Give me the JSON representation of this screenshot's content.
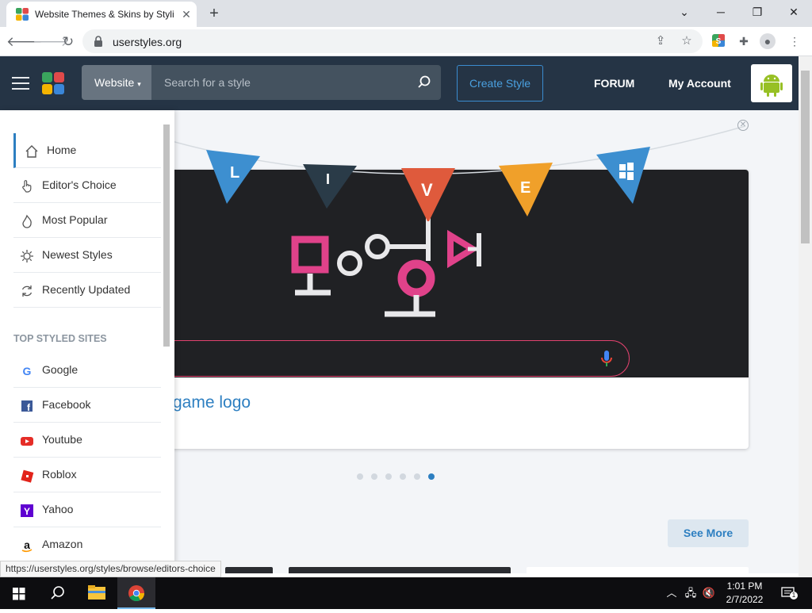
{
  "browser": {
    "tab_title": "Website Themes & Skins by Stylish",
    "url": "userstyles.org",
    "status_url": "https://userstyles.org/styles/browse/editors-choice"
  },
  "header": {
    "category_label": "Website",
    "search_placeholder": "Search for a style",
    "create_label": "Create Style",
    "forum_label": "FORUM",
    "account_label": "My Account"
  },
  "sidebar": {
    "nav": [
      {
        "label": "Home",
        "icon": "home-icon"
      },
      {
        "label": "Editor's Choice",
        "icon": "hand-pointer-icon"
      },
      {
        "label": "Most Popular",
        "icon": "flame-icon"
      },
      {
        "label": "Newest Styles",
        "icon": "sparkle-icon"
      },
      {
        "label": "Recently Updated",
        "icon": "refresh-icon"
      }
    ],
    "section_title": "TOP STYLED SITES",
    "sites": [
      {
        "label": "Google",
        "icon": "google-icon"
      },
      {
        "label": "Facebook",
        "icon": "facebook-icon"
      },
      {
        "label": "Youtube",
        "icon": "youtube-icon"
      },
      {
        "label": "Roblox",
        "icon": "roblox-icon"
      },
      {
        "label": "Yahoo",
        "icon": "yahoo-icon"
      },
      {
        "label": "Amazon",
        "icon": "amazon-icon"
      }
    ]
  },
  "hero": {
    "caption": "game logo",
    "banner_letters": [
      "L",
      "I",
      "V",
      "E"
    ]
  },
  "main": {
    "see_more_label": "See More"
  },
  "taskbar": {
    "time": "1:01 PM",
    "date": "2/7/2022",
    "notification_count": "1"
  },
  "colors": {
    "header_bg": "#253445",
    "accent": "#2d7fc1",
    "pink": "#e0426e"
  }
}
